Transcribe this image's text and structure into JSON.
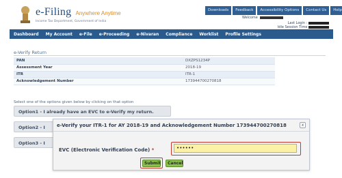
{
  "header": {
    "brand_title": "e-Filing",
    "brand_hindi": "Anywhere Anytime",
    "brand_sub": "Income Tax Department, Government of India",
    "links": [
      "Downloads",
      "Feedback",
      "Accessibility Options",
      "Contact Us",
      "Help"
    ],
    "welcome_prefix": "Welcome",
    "last_login_prefix": "Last Login",
    "session_prefix": "Idle Session Time"
  },
  "nav": {
    "items": [
      "Dashboard",
      "My Account",
      "e-File",
      "e-Proceeding",
      "e-Nivaran",
      "Compliance",
      "Worklist",
      "Profile Settings"
    ]
  },
  "page": {
    "title": "e-Verify Return",
    "instruction": "Select one of the options given below by clicking on that option",
    "rows": [
      {
        "label": "PAN",
        "value": "DXZPS1234P"
      },
      {
        "label": "Assessment Year",
        "value": "2018-19"
      },
      {
        "label": "ITR",
        "value": "ITR-1"
      },
      {
        "label": "Acknowledgement Number",
        "value": "173944700270818"
      }
    ],
    "options": [
      "Option1 - I already have an EVC to e-Verify my return.",
      "Option2 - I",
      "Option3 - I"
    ]
  },
  "modal": {
    "title": "e-Verify your ITR-1 for AY 2018-19 and Acknowledgement Number 173944700270818",
    "close": "x",
    "evc_label": "EVC (Electronic Verification Code)",
    "required_mark": "*",
    "evc_value": "••••••",
    "submit": "Submit",
    "cancel": "Cancel"
  },
  "colors": {
    "nav_bg": "#2b5a8d",
    "highlight_red": "#c0392b",
    "button_green": "#8ac14a",
    "input_yellow": "#fbf2a8"
  }
}
